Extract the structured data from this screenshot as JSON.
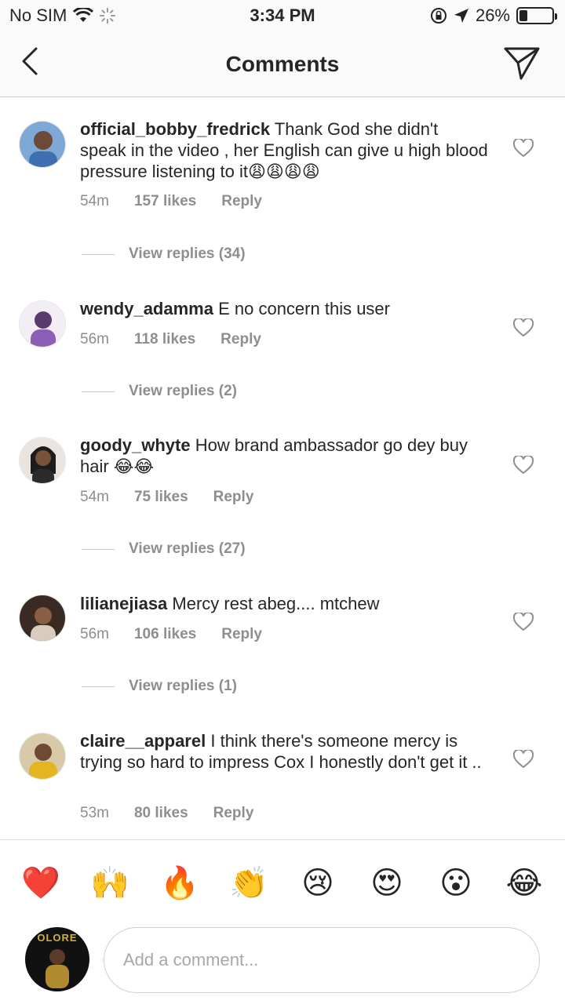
{
  "status_bar": {
    "carrier": "No SIM",
    "time": "3:34 PM",
    "battery": "26%",
    "battery_level": 0.26
  },
  "nav": {
    "title": "Comments",
    "back_icon": "chevron-left-icon",
    "send_icon": "paper-plane-icon"
  },
  "comments": [
    {
      "username": "official_bobby_fredrick",
      "text": "Thank God she didn't speak in the video , her English can give u high blood pressure listening to it😩😩😩😩",
      "time": "54m",
      "likes": "157 likes",
      "reply": "Reply",
      "view_replies": "View replies (34)"
    },
    {
      "username": "wendy_adamma",
      "text": "E no concern this user",
      "time": "56m",
      "likes": "118 likes",
      "reply": "Reply",
      "view_replies": "View replies (2)"
    },
    {
      "username": "goody_whyte",
      "text": "How brand ambassador go dey buy hair 😂😂",
      "time": "54m",
      "likes": "75 likes",
      "reply": "Reply",
      "view_replies": "View replies (27)"
    },
    {
      "username": "lilianejiasa",
      "text": "Mercy rest abeg.... mtchew",
      "time": "56m",
      "likes": "106 likes",
      "reply": "Reply",
      "view_replies": "View replies (1)"
    },
    {
      "username": "claire__apparel",
      "text": "I think there's someone mercy is trying so hard to impress Cox I honestly don't get it ..",
      "time": "53m",
      "likes": "80 likes",
      "reply": "Reply"
    }
  ],
  "reactions": [
    "❤️",
    "🙌",
    "🔥",
    "👏",
    "😢",
    "😍",
    "😮",
    "😂"
  ],
  "composer": {
    "placeholder": "Add a comment...",
    "avatar_text": "OLORE"
  },
  "colors": {
    "text": "#262626",
    "muted": "#8e8e8e",
    "bar_bg": "#fafafa"
  }
}
